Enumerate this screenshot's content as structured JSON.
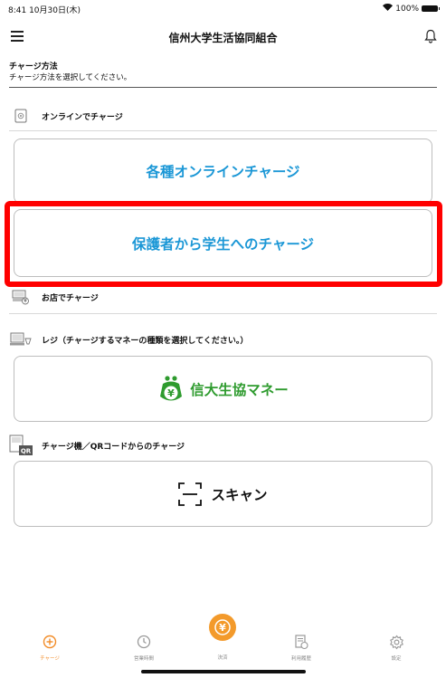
{
  "status_bar": {
    "time": "8:41  10月30日(木)",
    "battery": "100%"
  },
  "header": {
    "title": "信州大学生活協同組合"
  },
  "charge_method": {
    "title": "チャージ方法",
    "subtitle": "チャージ方法を選択してください。"
  },
  "online": {
    "label": "オンラインでチャージ",
    "buttons": [
      "各種オンラインチャージ",
      "保護者から学生へのチャージ"
    ]
  },
  "store": {
    "label": "お店でチャージ"
  },
  "register": {
    "label": "レジ（チャージするマネーの種類を選択してください。）",
    "money_button": "信大生協マネー",
    "money_icon_glyph": "¥"
  },
  "machine": {
    "label": "チャージ機／QRコードからのチャージ",
    "scan_button": "スキャン",
    "qr_badge": "QR"
  },
  "tab_bar": {
    "tabs": [
      {
        "label": "チャージ",
        "icon": "plus-circle-icon",
        "active": true
      },
      {
        "label": "営業時間",
        "icon": "clock-icon",
        "active": false
      },
      {
        "label": "決済",
        "icon": "yen-circle-icon",
        "active": false
      },
      {
        "label": "利用履歴",
        "icon": "receipt-icon",
        "active": false
      },
      {
        "label": "設定",
        "icon": "gear-icon",
        "active": false
      }
    ]
  },
  "colors": {
    "accent_blue": "#1b97d6",
    "money_green": "#2e9b2e",
    "tab_orange": "#f28c28",
    "highlight_red": "#ff0000"
  }
}
